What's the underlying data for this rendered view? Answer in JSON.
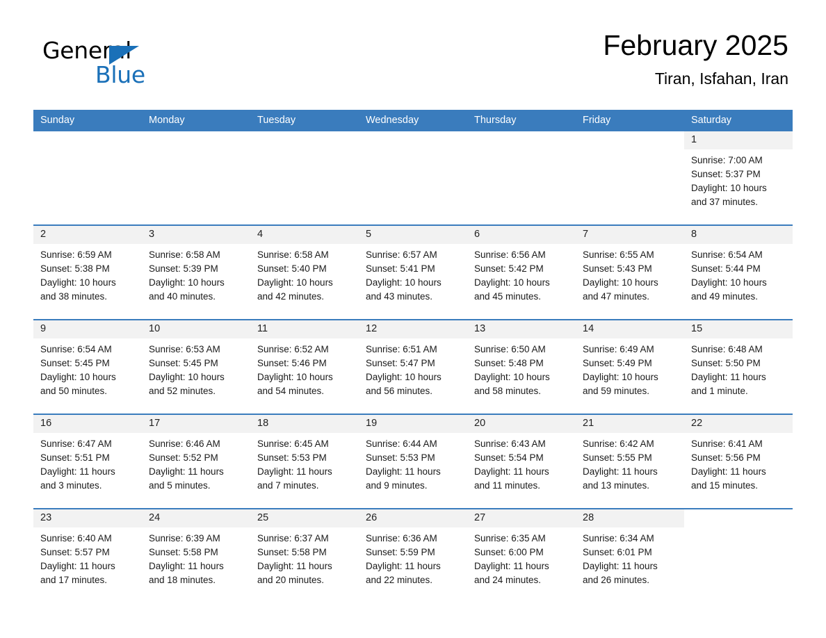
{
  "brand": {
    "word_one": "General",
    "word_two": "Blue",
    "flag_icon": "triangle-flag-icon",
    "accent_color": "#1a70b8"
  },
  "header": {
    "month_title": "February 2025",
    "location": "Tiran, Isfahan, Iran"
  },
  "calendar": {
    "header_background": "#3a7cbd",
    "daynum_background": "#f2f2f2",
    "weekday_headers": [
      "Sunday",
      "Monday",
      "Tuesday",
      "Wednesday",
      "Thursday",
      "Friday",
      "Saturday"
    ],
    "weeks": [
      [
        {
          "day": "",
          "lines": []
        },
        {
          "day": "",
          "lines": []
        },
        {
          "day": "",
          "lines": []
        },
        {
          "day": "",
          "lines": []
        },
        {
          "day": "",
          "lines": []
        },
        {
          "day": "",
          "lines": []
        },
        {
          "day": "1",
          "lines": [
            "Sunrise: 7:00 AM",
            "Sunset: 5:37 PM",
            "Daylight: 10 hours",
            "and 37 minutes."
          ]
        }
      ],
      [
        {
          "day": "2",
          "lines": [
            "Sunrise: 6:59 AM",
            "Sunset: 5:38 PM",
            "Daylight: 10 hours",
            "and 38 minutes."
          ]
        },
        {
          "day": "3",
          "lines": [
            "Sunrise: 6:58 AM",
            "Sunset: 5:39 PM",
            "Daylight: 10 hours",
            "and 40 minutes."
          ]
        },
        {
          "day": "4",
          "lines": [
            "Sunrise: 6:58 AM",
            "Sunset: 5:40 PM",
            "Daylight: 10 hours",
            "and 42 minutes."
          ]
        },
        {
          "day": "5",
          "lines": [
            "Sunrise: 6:57 AM",
            "Sunset: 5:41 PM",
            "Daylight: 10 hours",
            "and 43 minutes."
          ]
        },
        {
          "day": "6",
          "lines": [
            "Sunrise: 6:56 AM",
            "Sunset: 5:42 PM",
            "Daylight: 10 hours",
            "and 45 minutes."
          ]
        },
        {
          "day": "7",
          "lines": [
            "Sunrise: 6:55 AM",
            "Sunset: 5:43 PM",
            "Daylight: 10 hours",
            "and 47 minutes."
          ]
        },
        {
          "day": "8",
          "lines": [
            "Sunrise: 6:54 AM",
            "Sunset: 5:44 PM",
            "Daylight: 10 hours",
            "and 49 minutes."
          ]
        }
      ],
      [
        {
          "day": "9",
          "lines": [
            "Sunrise: 6:54 AM",
            "Sunset: 5:45 PM",
            "Daylight: 10 hours",
            "and 50 minutes."
          ]
        },
        {
          "day": "10",
          "lines": [
            "Sunrise: 6:53 AM",
            "Sunset: 5:45 PM",
            "Daylight: 10 hours",
            "and 52 minutes."
          ]
        },
        {
          "day": "11",
          "lines": [
            "Sunrise: 6:52 AM",
            "Sunset: 5:46 PM",
            "Daylight: 10 hours",
            "and 54 minutes."
          ]
        },
        {
          "day": "12",
          "lines": [
            "Sunrise: 6:51 AM",
            "Sunset: 5:47 PM",
            "Daylight: 10 hours",
            "and 56 minutes."
          ]
        },
        {
          "day": "13",
          "lines": [
            "Sunrise: 6:50 AM",
            "Sunset: 5:48 PM",
            "Daylight: 10 hours",
            "and 58 minutes."
          ]
        },
        {
          "day": "14",
          "lines": [
            "Sunrise: 6:49 AM",
            "Sunset: 5:49 PM",
            "Daylight: 10 hours",
            "and 59 minutes."
          ]
        },
        {
          "day": "15",
          "lines": [
            "Sunrise: 6:48 AM",
            "Sunset: 5:50 PM",
            "Daylight: 11 hours",
            "and 1 minute."
          ]
        }
      ],
      [
        {
          "day": "16",
          "lines": [
            "Sunrise: 6:47 AM",
            "Sunset: 5:51 PM",
            "Daylight: 11 hours",
            "and 3 minutes."
          ]
        },
        {
          "day": "17",
          "lines": [
            "Sunrise: 6:46 AM",
            "Sunset: 5:52 PM",
            "Daylight: 11 hours",
            "and 5 minutes."
          ]
        },
        {
          "day": "18",
          "lines": [
            "Sunrise: 6:45 AM",
            "Sunset: 5:53 PM",
            "Daylight: 11 hours",
            "and 7 minutes."
          ]
        },
        {
          "day": "19",
          "lines": [
            "Sunrise: 6:44 AM",
            "Sunset: 5:53 PM",
            "Daylight: 11 hours",
            "and 9 minutes."
          ]
        },
        {
          "day": "20",
          "lines": [
            "Sunrise: 6:43 AM",
            "Sunset: 5:54 PM",
            "Daylight: 11 hours",
            "and 11 minutes."
          ]
        },
        {
          "day": "21",
          "lines": [
            "Sunrise: 6:42 AM",
            "Sunset: 5:55 PM",
            "Daylight: 11 hours",
            "and 13 minutes."
          ]
        },
        {
          "day": "22",
          "lines": [
            "Sunrise: 6:41 AM",
            "Sunset: 5:56 PM",
            "Daylight: 11 hours",
            "and 15 minutes."
          ]
        }
      ],
      [
        {
          "day": "23",
          "lines": [
            "Sunrise: 6:40 AM",
            "Sunset: 5:57 PM",
            "Daylight: 11 hours",
            "and 17 minutes."
          ]
        },
        {
          "day": "24",
          "lines": [
            "Sunrise: 6:39 AM",
            "Sunset: 5:58 PM",
            "Daylight: 11 hours",
            "and 18 minutes."
          ]
        },
        {
          "day": "25",
          "lines": [
            "Sunrise: 6:37 AM",
            "Sunset: 5:58 PM",
            "Daylight: 11 hours",
            "and 20 minutes."
          ]
        },
        {
          "day": "26",
          "lines": [
            "Sunrise: 6:36 AM",
            "Sunset: 5:59 PM",
            "Daylight: 11 hours",
            "and 22 minutes."
          ]
        },
        {
          "day": "27",
          "lines": [
            "Sunrise: 6:35 AM",
            "Sunset: 6:00 PM",
            "Daylight: 11 hours",
            "and 24 minutes."
          ]
        },
        {
          "day": "28",
          "lines": [
            "Sunrise: 6:34 AM",
            "Sunset: 6:01 PM",
            "Daylight: 11 hours",
            "and 26 minutes."
          ]
        },
        {
          "day": "",
          "lines": []
        }
      ]
    ]
  }
}
